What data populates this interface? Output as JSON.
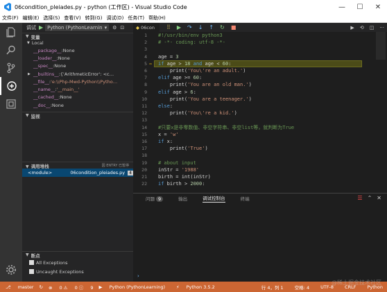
{
  "window": {
    "title": "06condition_pleiades.py - python (工作区) - Visual Studio Code",
    "controls": [
      "—",
      "☐",
      "✕"
    ]
  },
  "menu": [
    "文件(F)",
    "编辑(E)",
    "选择(S)",
    "查看(V)",
    "转到(G)",
    "调试(D)",
    "任务(T)",
    "帮助(H)"
  ],
  "debug_toolbar": {
    "label": "调试",
    "config": "Python (PythonLearnin",
    "play_icon": "▶"
  },
  "variables": {
    "section": "变量",
    "scope": "Local",
    "items": [
      {
        "name": "__package__",
        "value": "None",
        "expandable": false
      },
      {
        "name": "__loader__",
        "value": "None",
        "expandable": false
      },
      {
        "name": "__spec__",
        "value": "None",
        "expandable": false
      },
      {
        "name": "__builtins__",
        "value": "{'ArithmeticError': <c…",
        "expandable": true
      },
      {
        "name": "__file__",
        "value": "'e:\\\\Php-Mwd-Python\\\\Pytho…",
        "expandable": false,
        "string": true
      },
      {
        "name": "__name__",
        "value": "'__main__'",
        "expandable": false,
        "string": true
      },
      {
        "name": "__cached__",
        "value": "None",
        "expandable": false
      },
      {
        "name": "__doc__",
        "value": "None",
        "expandable": false
      }
    ]
  },
  "watch": {
    "section": "监视"
  },
  "callstack": {
    "section": "调用堆栈",
    "status": "因 ENTRY 已暂停",
    "frames": [
      {
        "name": "<module>",
        "file": "06condition_pleiades.py",
        "line": "4"
      }
    ]
  },
  "breakpoints": {
    "section": "断点",
    "items": [
      "All Exceptions",
      "Uncaught Exceptions"
    ]
  },
  "editor": {
    "tab": "06con",
    "current_line": 4,
    "lines": [
      {
        "n": "1",
        "html": "<span class='gray'>#!/usr/bin/env python3</span>"
      },
      {
        "n": "2",
        "html": "<span class='gray'># -*- coding: utf-8 -*-</span>"
      },
      {
        "n": "3",
        "html": ""
      },
      {
        "n": "4",
        "html": "age = <span class='num'>3</span>"
      },
      {
        "n": "5",
        "html": "<span class='kw'>if</span> age &gt; <span class='num'>18</span> <span class='kw'>and</span> age &lt; <span class='num'>60</span>:"
      },
      {
        "n": "6",
        "html": "    print(<span class='str'>'You\\'re an adult.'</span>)"
      },
      {
        "n": "7",
        "html": "<span class='kw'>elif</span> age &gt;= <span class='num'>60</span>:"
      },
      {
        "n": "8",
        "html": "    print(<span class='str'>'You are an old man.'</span>)"
      },
      {
        "n": "9",
        "html": "<span class='kw'>elif</span> age &gt; <span class='num'>6</span>:"
      },
      {
        "n": "10",
        "html": "    print(<span class='str'>'You are a teenager.'</span>)"
      },
      {
        "n": "11",
        "html": "<span class='kw'>else</span>:"
      },
      {
        "n": "12",
        "html": "    print(<span class='str'>'You\\'re a kid.'</span>)"
      },
      {
        "n": "13",
        "html": ""
      },
      {
        "n": "14",
        "html": "<span class='gray'>#只要x是非零数值、非空字符串、非空list等，就判断为True</span>"
      },
      {
        "n": "15",
        "html": "x = <span class='str'>'w'</span>"
      },
      {
        "n": "16",
        "html": "<span class='kw'>if</span> x:"
      },
      {
        "n": "17",
        "html": "    print(<span class='str'>'True'</span>)"
      },
      {
        "n": "18",
        "html": ""
      },
      {
        "n": "19",
        "html": "<span class='gray'># about input</span>"
      },
      {
        "n": "20",
        "html": "inStr = <span class='str'>'1988'</span>"
      },
      {
        "n": "21",
        "html": "birth = int(inStr)"
      },
      {
        "n": "22",
        "html": "<span class='kw'>if</span> birth &gt; <span class='num'>2000</span>:"
      }
    ]
  },
  "panel": {
    "tabs": [
      "问题",
      "输出",
      "调试控制台",
      "终端"
    ],
    "problems_badge": "9",
    "active_tab": "调试控制台",
    "prompt": "›"
  },
  "status": {
    "branch": "master",
    "errors": "0",
    "warnings": "0",
    "infos": "9",
    "config": "Python (PythonLearning)",
    "interpreter": "Python 3.5.2",
    "cursor": "行 4，列 1",
    "spaces": "空格: 4",
    "encoding": "UTF-8",
    "eol": "CRLF",
    "language": "Python"
  },
  "watermark": "@稀土掘金技术社区",
  "colors": {
    "statusbar": "#cc6633",
    "highlight": "#4b4b18"
  }
}
